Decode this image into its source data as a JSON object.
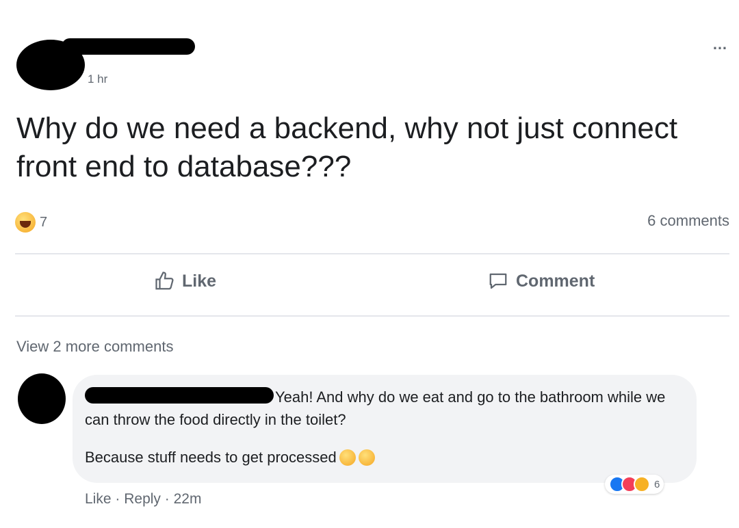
{
  "post": {
    "more_icon": "…",
    "timestamp": "1 hr",
    "text": "Why do we need a backend, why not just connect front end to database???",
    "reaction_count": "7",
    "comments_count": "6 comments",
    "like_label": "Like",
    "comment_label": "Comment"
  },
  "comments": {
    "view_more": "View 2 more comments",
    "items": [
      {
        "text": "Yeah! And why do we eat and go to the bathroom while we can throw the food directly in the toilet?",
        "text2": "Because stuff needs to get processed",
        "like": "Like",
        "reply": "Reply",
        "time": "22m",
        "sep": "·",
        "reaction_count": "6"
      }
    ]
  },
  "colors": {
    "like": "#1877f2",
    "love": "#f33e58",
    "haha": "#f7b125"
  }
}
